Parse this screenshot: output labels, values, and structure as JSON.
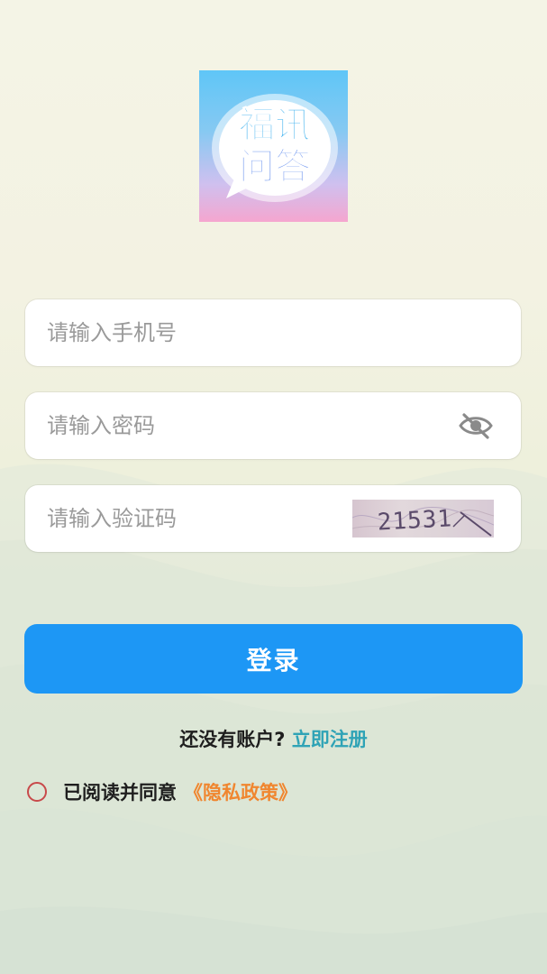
{
  "logo": {
    "line1": "福讯",
    "line2": "问答"
  },
  "form": {
    "phone_placeholder": "请输入手机号",
    "password_placeholder": "请输入密码",
    "captcha_placeholder": "请输入验证码",
    "captcha_text": "21531"
  },
  "icons": {
    "password_toggle": "eye-slash-icon",
    "agree_radio": "radio-circle-icon"
  },
  "actions": {
    "login_label": "登录",
    "no_account_text": "还没有账户?",
    "register_link": "立即注册"
  },
  "agreement": {
    "text": "已阅读并同意",
    "policy_link": "《隐私政策》"
  },
  "colors": {
    "primary": "#1d97f5",
    "register_link": "#2fa3b6",
    "policy_link": "#f0862f",
    "radio_border": "#c8494a"
  }
}
